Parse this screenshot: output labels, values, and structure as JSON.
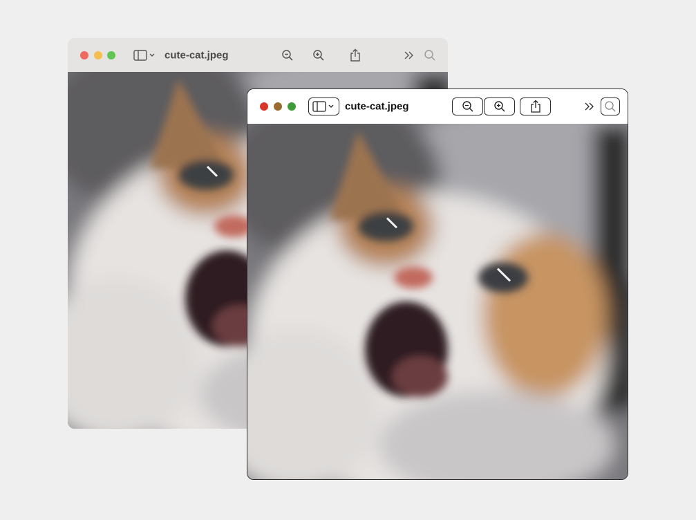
{
  "windows": {
    "back": {
      "filename": "cute-cat.jpeg",
      "traffic_lights": [
        "#ec6a5e",
        "#f4bf4f",
        "#61c554"
      ],
      "icons": [
        "sidebar-toggle-icon",
        "zoom-out-icon",
        "zoom-in-icon",
        "share-icon",
        "chevron-double-right-icon",
        "search-icon"
      ]
    },
    "front": {
      "filename": "cute-cat.jpeg",
      "traffic_lights": [
        "#d8352b",
        "#9a6b30",
        "#3f9a3a"
      ],
      "icons": [
        "sidebar-toggle-icon",
        "zoom-out-icon",
        "zoom-in-icon",
        "share-icon",
        "chevron-double-right-icon",
        "search-icon"
      ]
    }
  },
  "image_description_colors": {
    "fur_white": "#e9e6e4",
    "fur_orange": "#c08a55",
    "background_gray": "#8f8f94",
    "mouth": "#3a2528"
  }
}
